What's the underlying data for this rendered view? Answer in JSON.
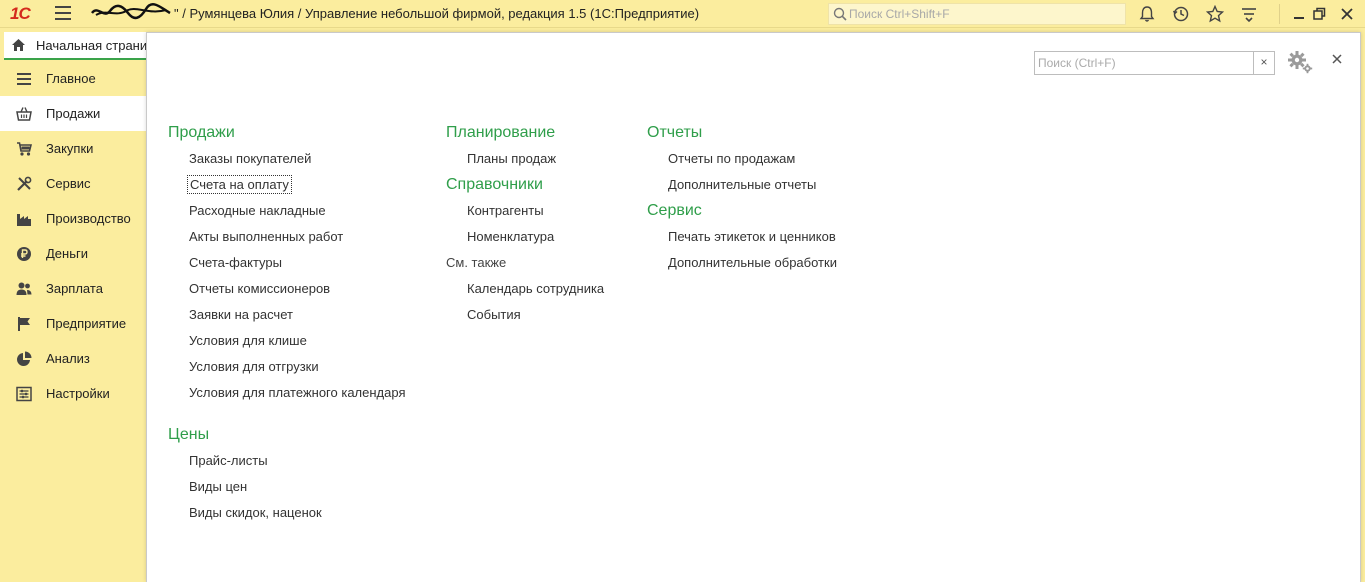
{
  "window": {
    "title": "\" / Румянцева Юлия / Управление небольшой фирмой, редакция 1.5  (1С:Предприятие)",
    "logo_text": "1С",
    "search_placeholder": "Поиск Ctrl+Shift+F"
  },
  "tabs": {
    "home_label": "Начальная страни"
  },
  "sidebar": {
    "items": [
      {
        "label": "Главное",
        "icon": "menu-lines-icon"
      },
      {
        "label": "Продажи",
        "icon": "basket-icon"
      },
      {
        "label": "Закупки",
        "icon": "cart-icon"
      },
      {
        "label": "Сервис",
        "icon": "tools-icon"
      },
      {
        "label": "Производство",
        "icon": "factory-icon"
      },
      {
        "label": "Деньги",
        "icon": "ruble-coin-icon"
      },
      {
        "label": "Зарплата",
        "icon": "people-icon"
      },
      {
        "label": "Предприятие",
        "icon": "flag-icon"
      },
      {
        "label": "Анализ",
        "icon": "pie-chart-icon"
      },
      {
        "label": "Настройки",
        "icon": "settings-list-icon"
      }
    ],
    "active_index": 1
  },
  "panel": {
    "search_placeholder": "Поиск (Ctrl+F)",
    "clear_label": "×",
    "columns": [
      {
        "sections": [
          {
            "title": "Продажи",
            "links": [
              "Заказы покупателей",
              "Счета на оплату",
              "Расходные накладные",
              "Акты выполненных работ",
              "Счета-фактуры",
              "Отчеты комиссионеров",
              "Заявки на расчет",
              "Условия для клише",
              "Условия для отгрузки",
              "Условия для платежного календаря"
            ]
          },
          {
            "title": "Цены",
            "links": [
              "Прайс-листы",
              "Виды цен",
              "Виды скидок, наценок"
            ]
          }
        ]
      },
      {
        "sections": [
          {
            "title": "Планирование",
            "links": [
              "Планы продаж"
            ]
          },
          {
            "title": "Справочники",
            "links": [
              "Контрагенты",
              "Номенклатура"
            ]
          },
          {
            "title": "См. также",
            "links": [
              "Календарь сотрудника",
              "События"
            ]
          }
        ]
      },
      {
        "sections": [
          {
            "title": "Отчеты",
            "links": [
              "Отчеты по продажам",
              "Дополнительные отчеты"
            ]
          },
          {
            "title": "Сервис",
            "links": [
              "Печать этикеток и ценников",
              "Дополнительные обработки"
            ]
          }
        ]
      }
    ]
  },
  "colors": {
    "accent_green": "#2f9e4a",
    "chrome_yellow": "#fbed9e",
    "logo_red": "#d42a1c"
  }
}
